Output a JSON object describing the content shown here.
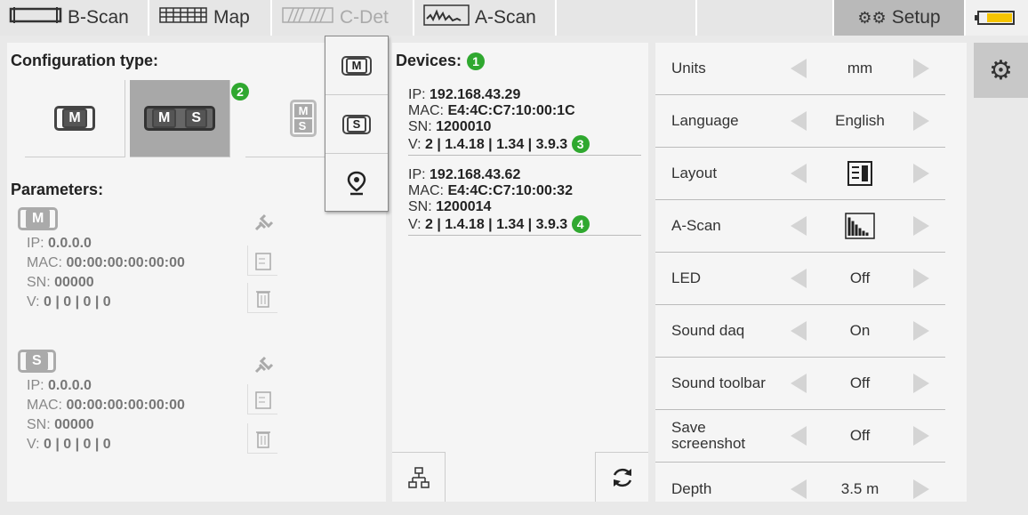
{
  "tabs": [
    {
      "label": "B-Scan",
      "icon": "bscan-icon"
    },
    {
      "label": "Map",
      "icon": "map-grid-icon"
    },
    {
      "label": "C-Det",
      "icon": "cdet-icon"
    },
    {
      "label": "A-Scan",
      "icon": "ascan-icon"
    },
    {
      "label": "Setup",
      "icon": "gears-icon"
    }
  ],
  "config": {
    "title": "Configuration type:",
    "badge": "2",
    "buttons": [
      {
        "probes": [
          "M"
        ]
      },
      {
        "probes": [
          "M",
          "S"
        ]
      },
      {
        "probes": [
          "M",
          "S"
        ]
      }
    ]
  },
  "params": {
    "title": "Parameters:",
    "items": [
      {
        "probe": "M",
        "ip_label": "IP: ",
        "ip": "0.0.0.0",
        "mac_label": "MAC: ",
        "mac": "00:00:00:00:00:00",
        "sn_label": "SN: ",
        "sn": "00000",
        "v_label": "V: ",
        "v": "0 | 0 | 0 | 0"
      },
      {
        "probe": "S",
        "ip_label": "IP: ",
        "ip": "0.0.0.0",
        "mac_label": "MAC: ",
        "mac": "00:00:00:00:00:00",
        "sn_label": "SN: ",
        "sn": "00000",
        "v_label": "V: ",
        "v": "0 | 0 | 0 | 0"
      }
    ]
  },
  "devices": {
    "title": "Devices:",
    "badge": "1",
    "items": [
      {
        "ip_label": "IP: ",
        "ip": "192.168.43.29",
        "mac_label": "MAC: ",
        "mac": "E4:4C:C7:10:00:1C",
        "sn_label": "SN: ",
        "sn": "1200010",
        "v_label": "V: ",
        "v": "2 | 1.4.18 | 1.34 | 3.9.3",
        "badge": "3"
      },
      {
        "ip_label": "IP: ",
        "ip": "192.168.43.62",
        "mac_label": "MAC: ",
        "mac": "E4:4C:C7:10:00:32",
        "sn_label": "SN: ",
        "sn": "1200014",
        "v_label": "V: ",
        "v": "2 | 1.4.18 | 1.34 | 3.9.3",
        "badge": "4"
      }
    ]
  },
  "popup": {
    "items": [
      "M",
      "S",
      "location-pin-icon"
    ]
  },
  "settings": [
    {
      "label": "Units",
      "value": "mm"
    },
    {
      "label": "Language",
      "value": "English"
    },
    {
      "label": "Layout",
      "value": "",
      "icon": "layout-icon"
    },
    {
      "label": "A-Scan",
      "value": "",
      "icon": "ascan-graph-icon"
    },
    {
      "label": "LED",
      "value": "Off"
    },
    {
      "label": "Sound daq",
      "value": "On"
    },
    {
      "label": "Sound toolbar",
      "value": "Off"
    },
    {
      "label": "Save screenshot",
      "value": "Off"
    },
    {
      "label": "Depth",
      "value": "3.5 m"
    }
  ],
  "colors": {
    "badge": "#2fa82f",
    "selected": "#a8a8a8",
    "battery": "#f5c400"
  }
}
